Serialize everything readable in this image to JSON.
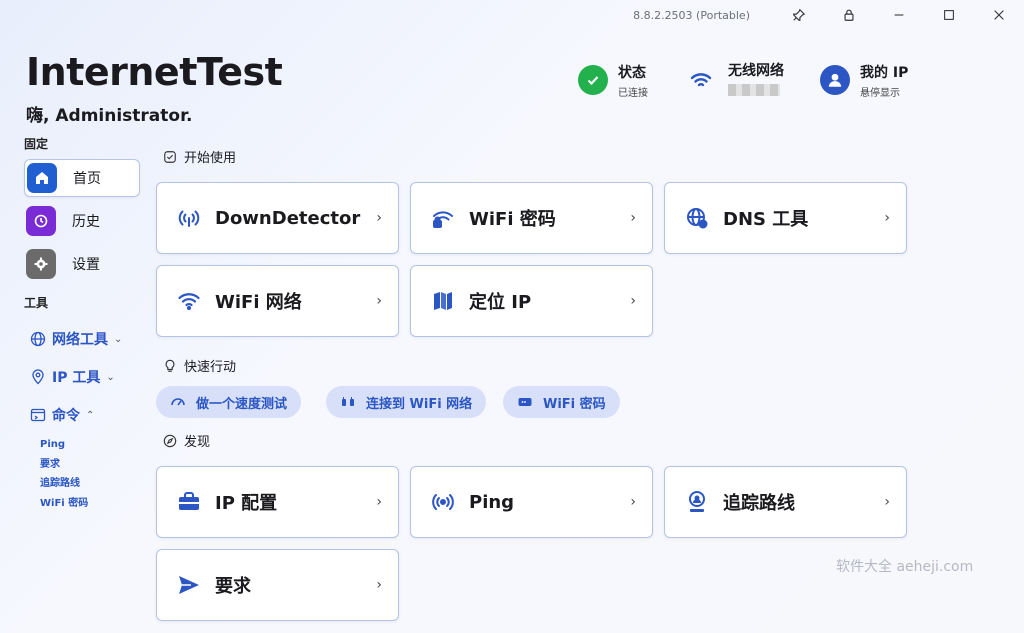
{
  "window": {
    "version": "8.8.2.2503 (Portable)"
  },
  "app": {
    "title": "InternetTest",
    "greeting": "嗨, Administrator."
  },
  "status": {
    "state": {
      "title": "状态",
      "sub": "已连接"
    },
    "wifi": {
      "title": "无线网络"
    },
    "myip": {
      "title": "我的 IP",
      "sub": "悬停显示"
    }
  },
  "sidebar": {
    "pinned_heading": "固定",
    "pinned": [
      {
        "label": "首页",
        "color": "#1f5fd1"
      },
      {
        "label": "历史",
        "color": "#7a2bd6"
      },
      {
        "label": "设置",
        "color": "#6b6b6b"
      }
    ],
    "tools_heading": "工具",
    "tools": [
      {
        "label": "网络工具",
        "chev": "⌄"
      },
      {
        "label": "IP 工具",
        "chev": "⌄"
      },
      {
        "label": "命令",
        "chev": "⌃"
      }
    ],
    "commands": [
      "Ping",
      "要求",
      "追踪路线",
      "WiFi 密码"
    ]
  },
  "sections": {
    "start": "开始使用",
    "quick": "快速行动",
    "discover": "发现"
  },
  "cards": {
    "start": [
      "DownDetector",
      "WiFi 密码",
      "DNS 工具",
      "WiFi 网络",
      "定位 IP"
    ],
    "discover": [
      "IP 配置",
      "Ping",
      "追踪路线",
      "要求"
    ]
  },
  "quick_actions": [
    "做一个速度测试",
    "连接到 WiFi 网络",
    "WiFi 密码"
  ],
  "watermark": "软件大全 aeheji.com",
  "colors": {
    "accent": "#2b56c4",
    "success": "#22b14c",
    "card_border": "#b5c3e3"
  }
}
